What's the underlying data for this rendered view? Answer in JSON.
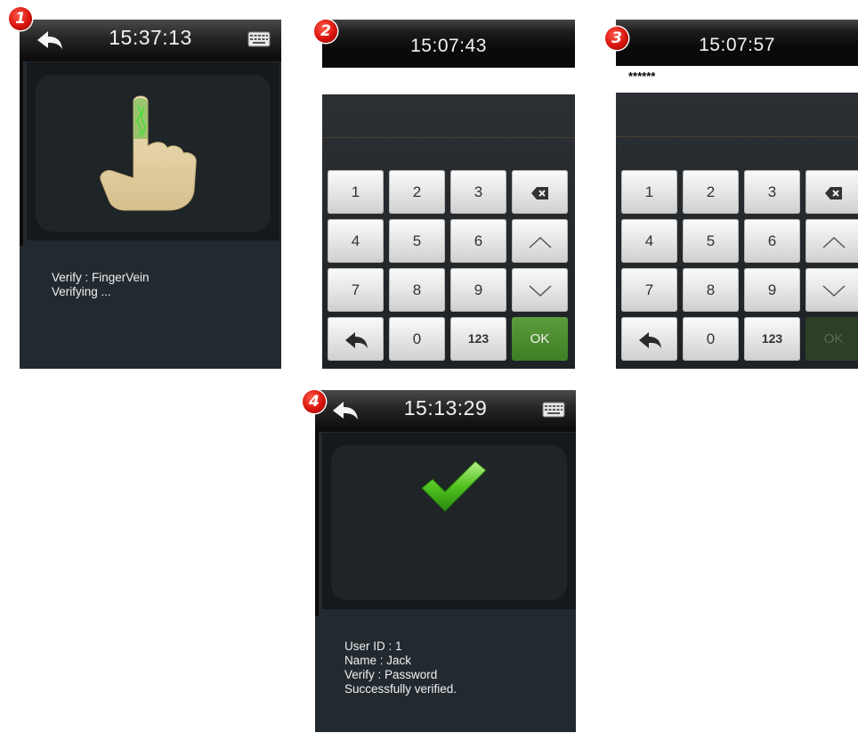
{
  "screens": {
    "s1": {
      "badge": "1",
      "clock": "15:37:13",
      "info": {
        "line1": "Verify : FingerVein",
        "line2": "Verifying ..."
      }
    },
    "s2": {
      "badge": "2",
      "clock": "15:07:43",
      "input_value": ""
    },
    "s3": {
      "badge": "3",
      "clock": "15:07:57",
      "input_value": "******"
    },
    "s4": {
      "badge": "4",
      "clock": "15:13:29",
      "info": {
        "line1": "User ID : 1",
        "line2": "Name : Jack",
        "line3": "Verify : Password",
        "line4": "Successfully verified."
      }
    }
  },
  "keypad": {
    "k1": "1",
    "k2": "2",
    "k3": "3",
    "k4": "4",
    "k5": "5",
    "k6": "6",
    "k7": "7",
    "k8": "8",
    "k9": "9",
    "k0": "0",
    "k123": "123",
    "ok": "OK"
  },
  "icons": [
    "back-arrow-icon",
    "keyboard-icon",
    "backspace-icon",
    "chevron-up-icon",
    "chevron-down-icon",
    "finger-vein-hand-icon",
    "checkmark-icon"
  ],
  "colors": {
    "ok_green": "#3e7d24",
    "badge_red": "#d8140c",
    "screen_dark": "#1c2024"
  }
}
